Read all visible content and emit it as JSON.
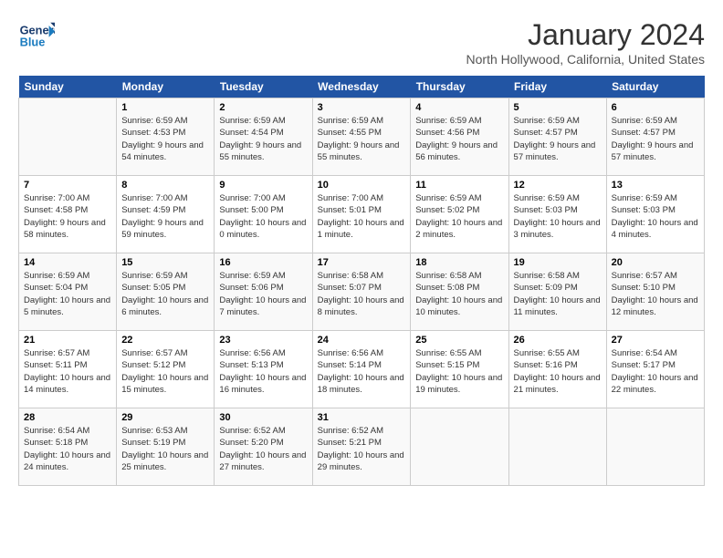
{
  "header": {
    "logo_line1": "General",
    "logo_line2": "Blue",
    "month": "January 2024",
    "location": "North Hollywood, California, United States"
  },
  "weekdays": [
    "Sunday",
    "Monday",
    "Tuesday",
    "Wednesday",
    "Thursday",
    "Friday",
    "Saturday"
  ],
  "weeks": [
    [
      {
        "day": "",
        "sunrise": "",
        "sunset": "",
        "daylight": ""
      },
      {
        "day": "1",
        "sunrise": "Sunrise: 6:59 AM",
        "sunset": "Sunset: 4:53 PM",
        "daylight": "Daylight: 9 hours and 54 minutes."
      },
      {
        "day": "2",
        "sunrise": "Sunrise: 6:59 AM",
        "sunset": "Sunset: 4:54 PM",
        "daylight": "Daylight: 9 hours and 55 minutes."
      },
      {
        "day": "3",
        "sunrise": "Sunrise: 6:59 AM",
        "sunset": "Sunset: 4:55 PM",
        "daylight": "Daylight: 9 hours and 55 minutes."
      },
      {
        "day": "4",
        "sunrise": "Sunrise: 6:59 AM",
        "sunset": "Sunset: 4:56 PM",
        "daylight": "Daylight: 9 hours and 56 minutes."
      },
      {
        "day": "5",
        "sunrise": "Sunrise: 6:59 AM",
        "sunset": "Sunset: 4:57 PM",
        "daylight": "Daylight: 9 hours and 57 minutes."
      },
      {
        "day": "6",
        "sunrise": "Sunrise: 6:59 AM",
        "sunset": "Sunset: 4:57 PM",
        "daylight": "Daylight: 9 hours and 57 minutes."
      }
    ],
    [
      {
        "day": "7",
        "sunrise": "Sunrise: 7:00 AM",
        "sunset": "Sunset: 4:58 PM",
        "daylight": "Daylight: 9 hours and 58 minutes."
      },
      {
        "day": "8",
        "sunrise": "Sunrise: 7:00 AM",
        "sunset": "Sunset: 4:59 PM",
        "daylight": "Daylight: 9 hours and 59 minutes."
      },
      {
        "day": "9",
        "sunrise": "Sunrise: 7:00 AM",
        "sunset": "Sunset: 5:00 PM",
        "daylight": "Daylight: 10 hours and 0 minutes."
      },
      {
        "day": "10",
        "sunrise": "Sunrise: 7:00 AM",
        "sunset": "Sunset: 5:01 PM",
        "daylight": "Daylight: 10 hours and 1 minute."
      },
      {
        "day": "11",
        "sunrise": "Sunrise: 6:59 AM",
        "sunset": "Sunset: 5:02 PM",
        "daylight": "Daylight: 10 hours and 2 minutes."
      },
      {
        "day": "12",
        "sunrise": "Sunrise: 6:59 AM",
        "sunset": "Sunset: 5:03 PM",
        "daylight": "Daylight: 10 hours and 3 minutes."
      },
      {
        "day": "13",
        "sunrise": "Sunrise: 6:59 AM",
        "sunset": "Sunset: 5:03 PM",
        "daylight": "Daylight: 10 hours and 4 minutes."
      }
    ],
    [
      {
        "day": "14",
        "sunrise": "Sunrise: 6:59 AM",
        "sunset": "Sunset: 5:04 PM",
        "daylight": "Daylight: 10 hours and 5 minutes."
      },
      {
        "day": "15",
        "sunrise": "Sunrise: 6:59 AM",
        "sunset": "Sunset: 5:05 PM",
        "daylight": "Daylight: 10 hours and 6 minutes."
      },
      {
        "day": "16",
        "sunrise": "Sunrise: 6:59 AM",
        "sunset": "Sunset: 5:06 PM",
        "daylight": "Daylight: 10 hours and 7 minutes."
      },
      {
        "day": "17",
        "sunrise": "Sunrise: 6:58 AM",
        "sunset": "Sunset: 5:07 PM",
        "daylight": "Daylight: 10 hours and 8 minutes."
      },
      {
        "day": "18",
        "sunrise": "Sunrise: 6:58 AM",
        "sunset": "Sunset: 5:08 PM",
        "daylight": "Daylight: 10 hours and 10 minutes."
      },
      {
        "day": "19",
        "sunrise": "Sunrise: 6:58 AM",
        "sunset": "Sunset: 5:09 PM",
        "daylight": "Daylight: 10 hours and 11 minutes."
      },
      {
        "day": "20",
        "sunrise": "Sunrise: 6:57 AM",
        "sunset": "Sunset: 5:10 PM",
        "daylight": "Daylight: 10 hours and 12 minutes."
      }
    ],
    [
      {
        "day": "21",
        "sunrise": "Sunrise: 6:57 AM",
        "sunset": "Sunset: 5:11 PM",
        "daylight": "Daylight: 10 hours and 14 minutes."
      },
      {
        "day": "22",
        "sunrise": "Sunrise: 6:57 AM",
        "sunset": "Sunset: 5:12 PM",
        "daylight": "Daylight: 10 hours and 15 minutes."
      },
      {
        "day": "23",
        "sunrise": "Sunrise: 6:56 AM",
        "sunset": "Sunset: 5:13 PM",
        "daylight": "Daylight: 10 hours and 16 minutes."
      },
      {
        "day": "24",
        "sunrise": "Sunrise: 6:56 AM",
        "sunset": "Sunset: 5:14 PM",
        "daylight": "Daylight: 10 hours and 18 minutes."
      },
      {
        "day": "25",
        "sunrise": "Sunrise: 6:55 AM",
        "sunset": "Sunset: 5:15 PM",
        "daylight": "Daylight: 10 hours and 19 minutes."
      },
      {
        "day": "26",
        "sunrise": "Sunrise: 6:55 AM",
        "sunset": "Sunset: 5:16 PM",
        "daylight": "Daylight: 10 hours and 21 minutes."
      },
      {
        "day": "27",
        "sunrise": "Sunrise: 6:54 AM",
        "sunset": "Sunset: 5:17 PM",
        "daylight": "Daylight: 10 hours and 22 minutes."
      }
    ],
    [
      {
        "day": "28",
        "sunrise": "Sunrise: 6:54 AM",
        "sunset": "Sunset: 5:18 PM",
        "daylight": "Daylight: 10 hours and 24 minutes."
      },
      {
        "day": "29",
        "sunrise": "Sunrise: 6:53 AM",
        "sunset": "Sunset: 5:19 PM",
        "daylight": "Daylight: 10 hours and 25 minutes."
      },
      {
        "day": "30",
        "sunrise": "Sunrise: 6:52 AM",
        "sunset": "Sunset: 5:20 PM",
        "daylight": "Daylight: 10 hours and 27 minutes."
      },
      {
        "day": "31",
        "sunrise": "Sunrise: 6:52 AM",
        "sunset": "Sunset: 5:21 PM",
        "daylight": "Daylight: 10 hours and 29 minutes."
      },
      {
        "day": "",
        "sunrise": "",
        "sunset": "",
        "daylight": ""
      },
      {
        "day": "",
        "sunrise": "",
        "sunset": "",
        "daylight": ""
      },
      {
        "day": "",
        "sunrise": "",
        "sunset": "",
        "daylight": ""
      }
    ]
  ]
}
